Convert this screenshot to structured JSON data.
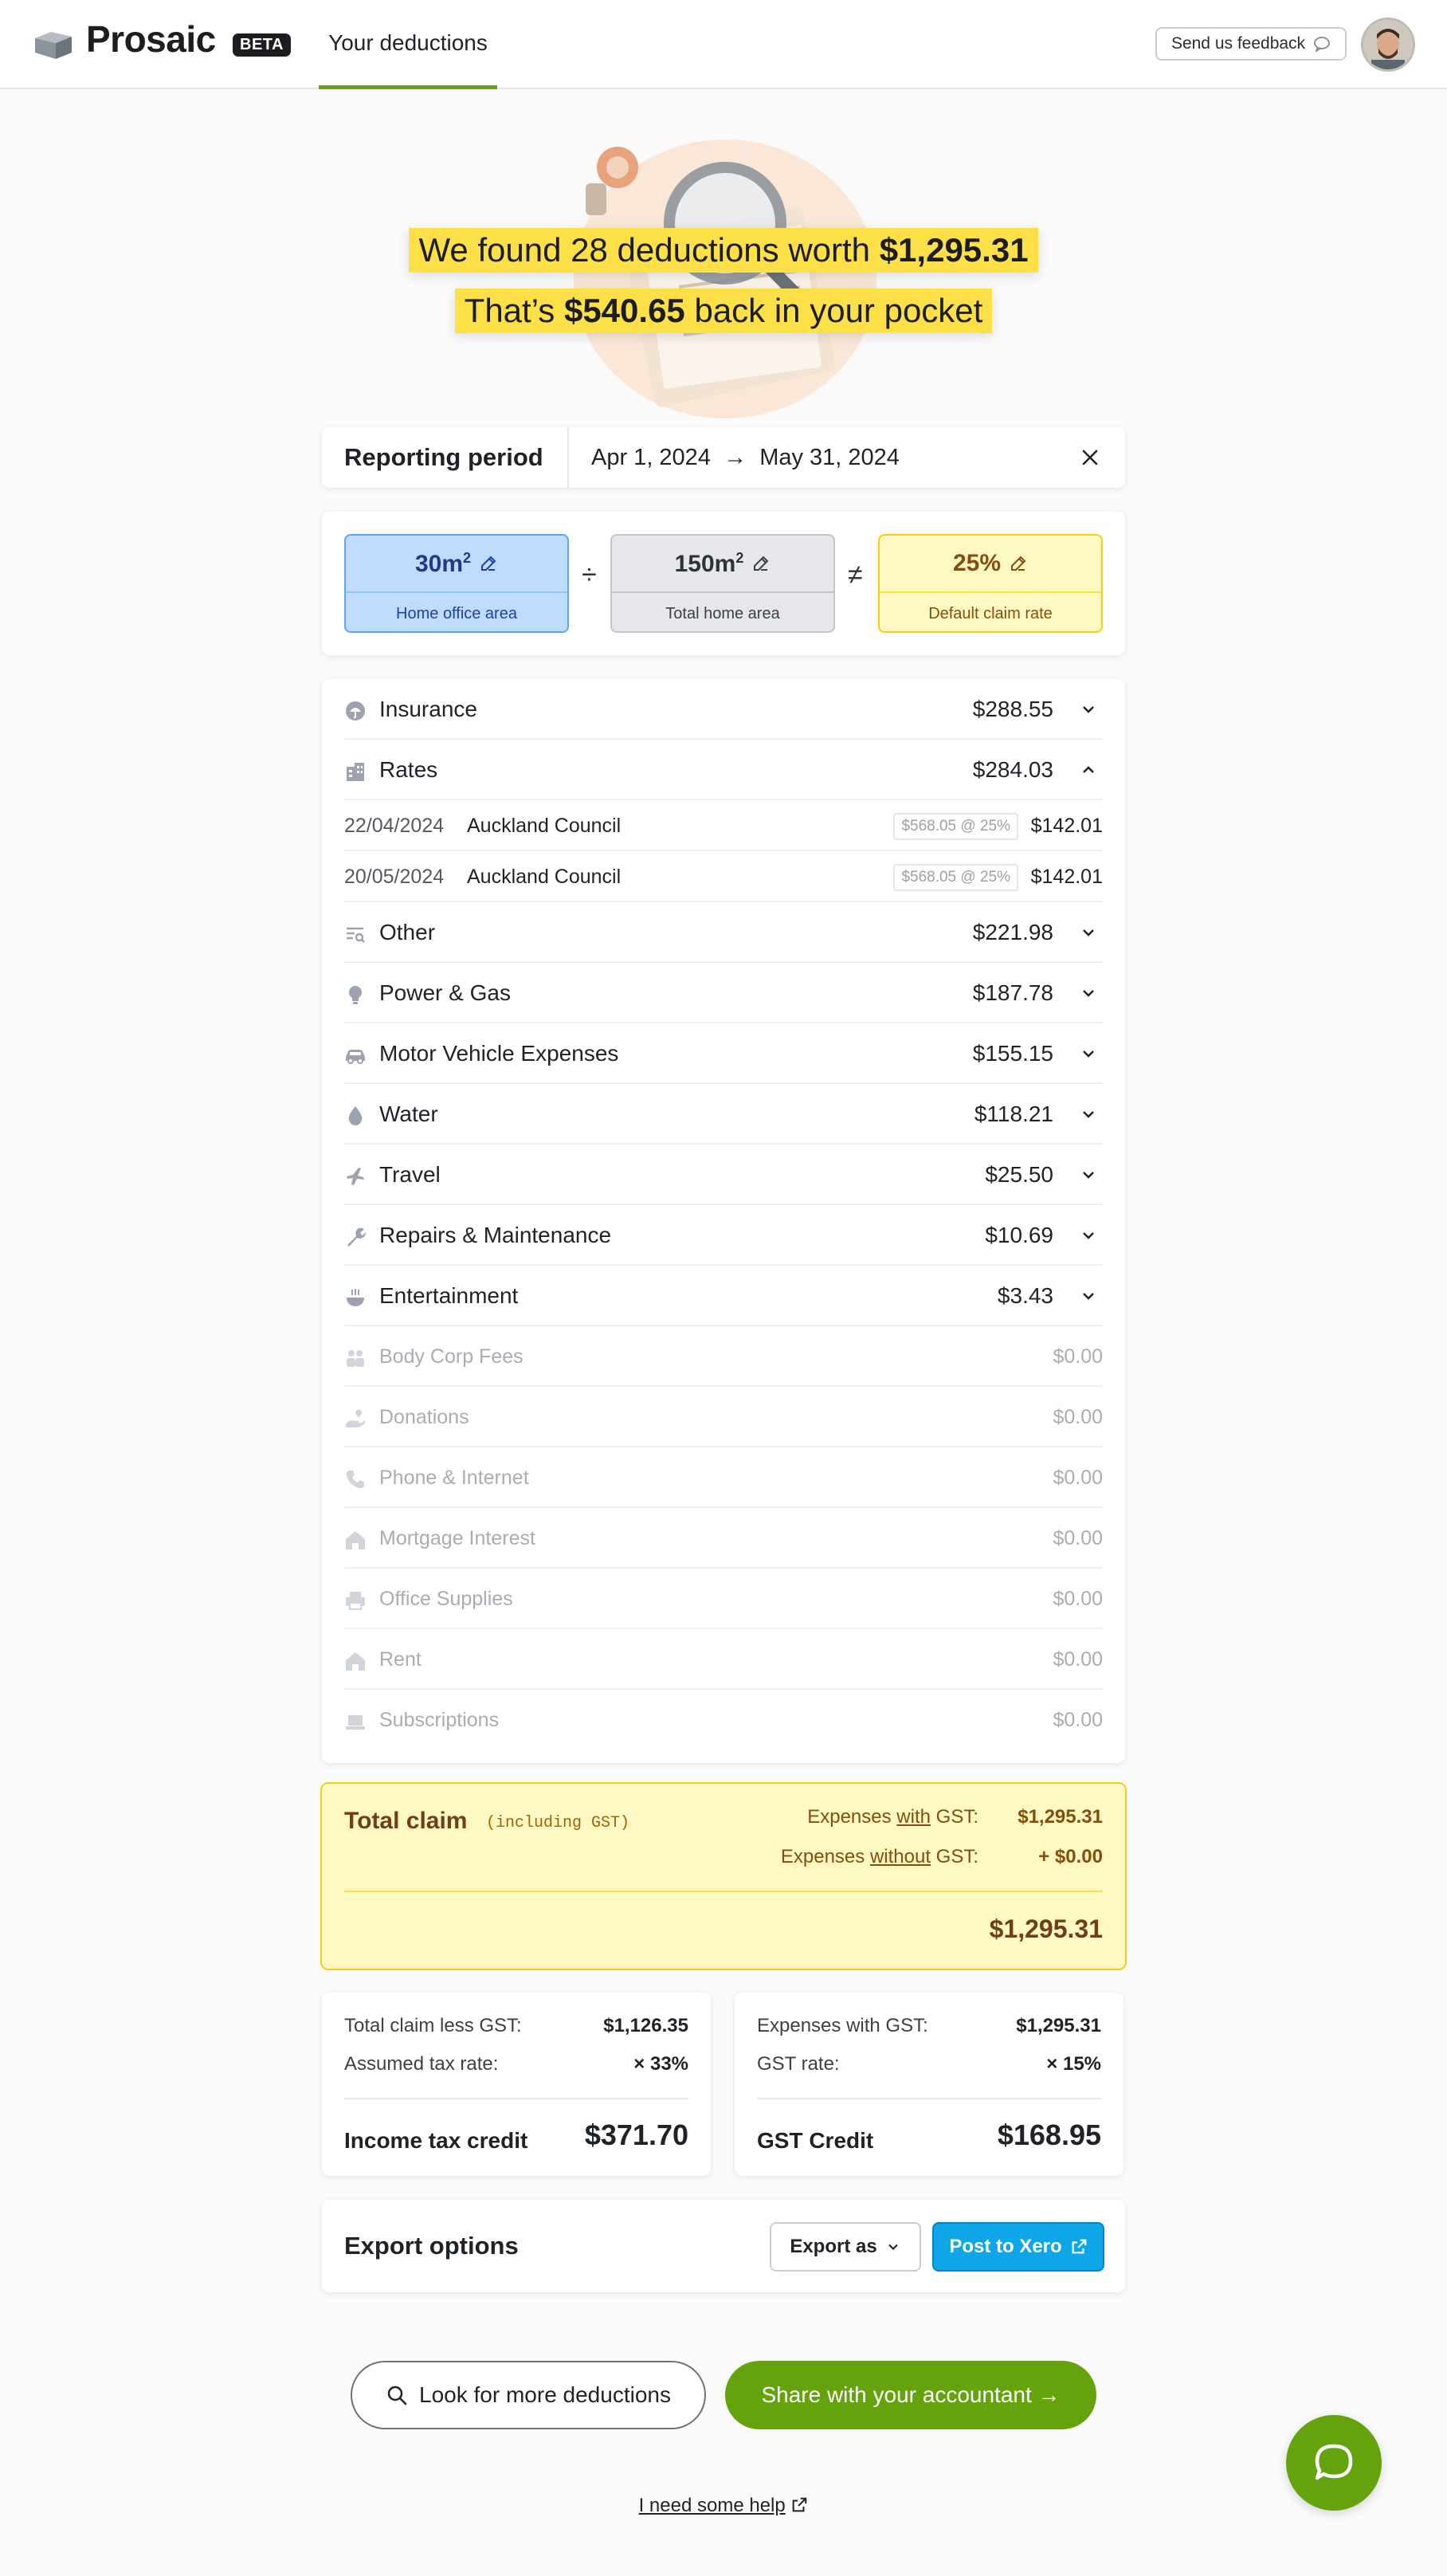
{
  "header": {
    "logo_text": "Prosaic",
    "beta_badge": "BETA",
    "nav_tab": "Your deductions",
    "feedback_label": "Send us feedback"
  },
  "hero": {
    "line1_prefix": "We found 28 deductions worth ",
    "line1_amount": "$1,295.31",
    "line2_prefix": "That’s ",
    "line2_amount": "$540.65",
    "line2_suffix": " back in your pocket"
  },
  "reporting_period": {
    "label": "Reporting period",
    "start": "Apr 1, 2024",
    "arrow": "→",
    "end": "May 31, 2024"
  },
  "areas": {
    "home_office": {
      "value": "30m",
      "sup": "2",
      "label": "Home office area"
    },
    "divide": "÷",
    "total_home": {
      "value": "150m",
      "sup": "2",
      "label": "Total home area"
    },
    "not_equal": "≠",
    "claim_rate": {
      "value": "25%",
      "label": "Default claim rate"
    }
  },
  "categories": [
    {
      "name": "Insurance",
      "amount": "$288.55",
      "icon": "umbrella-icon"
    },
    {
      "name": "Rates",
      "amount": "$284.03",
      "icon": "building-icon",
      "expanded": true,
      "items": [
        {
          "date": "22/04/2024",
          "payee": "Auckland Council",
          "badge": "$568.05 @ 25%",
          "amount": "$142.01"
        },
        {
          "date": "20/05/2024",
          "payee": "Auckland Council",
          "badge": "$568.05 @ 25%",
          "amount": "$142.01"
        }
      ]
    },
    {
      "name": "Other",
      "amount": "$221.98",
      "icon": "list-search-icon"
    },
    {
      "name": "Power & Gas",
      "amount": "$187.78",
      "icon": "lightbulb-icon"
    },
    {
      "name": "Motor Vehicle Expenses",
      "amount": "$155.15",
      "icon": "car-icon"
    },
    {
      "name": "Water",
      "amount": "$118.21",
      "icon": "water-drop-icon"
    },
    {
      "name": "Travel",
      "amount": "$25.50",
      "icon": "plane-icon"
    },
    {
      "name": "Repairs & Maintenance",
      "amount": "$10.69",
      "icon": "wrench-icon"
    },
    {
      "name": "Entertainment",
      "amount": "$3.43",
      "icon": "food-bowl-icon"
    },
    {
      "name": "Body Corp Fees",
      "amount": "$0.00",
      "icon": "people-icon"
    },
    {
      "name": "Donations",
      "amount": "$0.00",
      "icon": "hand-heart-icon"
    },
    {
      "name": "Phone & Internet",
      "amount": "$0.00",
      "icon": "phone-icon"
    },
    {
      "name": "Mortgage Interest",
      "amount": "$0.00",
      "icon": "home-icon"
    },
    {
      "name": "Office Supplies",
      "amount": "$0.00",
      "icon": "printer-icon"
    },
    {
      "name": "Rent",
      "amount": "$0.00",
      "icon": "home-icon"
    },
    {
      "name": "Subscriptions",
      "amount": "$0.00",
      "icon": "laptop-icon"
    }
  ],
  "total_claim": {
    "title": "Total claim",
    "subtitle": "(including GST)",
    "with_gst_prefix": "Expenses ",
    "with_gst_word": "with",
    "with_gst_suffix": " GST:",
    "with_gst_value": "$1,295.31",
    "without_gst_prefix": "Expenses ",
    "without_gst_word": "without",
    "without_gst_suffix": " GST:",
    "without_gst_value": "+ $0.00",
    "total": "$1,295.31"
  },
  "income_tax": {
    "line1_label": "Total claim less GST:",
    "line1_value": "$1,126.35",
    "line2_label": "Assumed tax rate:",
    "line2_value": "× 33%",
    "title": "Income tax credit",
    "value": "$371.70"
  },
  "gst_credit": {
    "line1_label": "Expenses with GST:",
    "line1_value": "$1,295.31",
    "line2_label": "GST rate:",
    "line2_value": "× 15%",
    "title": "GST Credit",
    "value": "$168.95"
  },
  "export": {
    "title": "Export options",
    "export_as": "Export as",
    "post_xero": "Post to Xero"
  },
  "actions": {
    "more_deductions": "Look for more deductions",
    "share": "Share with your accountant →",
    "help": "I need some help"
  },
  "colors": {
    "brand_green": "#65a30d",
    "highlight_yellow": "#fde047",
    "xero_blue": "#0ea5e9"
  }
}
